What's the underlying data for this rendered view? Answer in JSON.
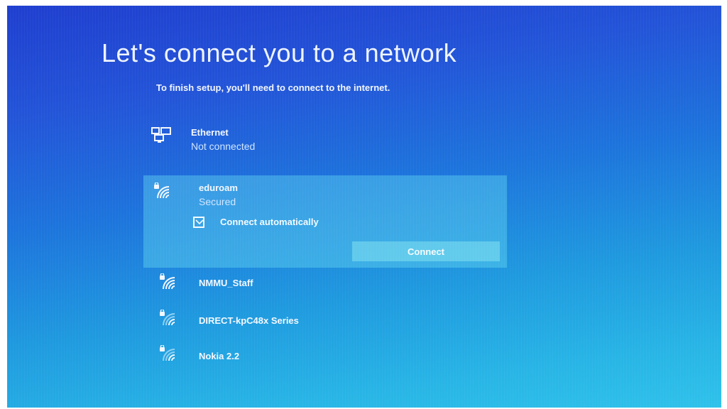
{
  "page": {
    "title": "Let's connect you to a network",
    "subtitle": "To finish setup, you'll need to connect to the internet."
  },
  "ethernet": {
    "icon": "ethernet-icon",
    "name": "Ethernet",
    "status": "Not connected"
  },
  "selected_network": {
    "icon": "wifi-secured-icon",
    "name": "eduroam",
    "status": "Secured",
    "connect_automatically": {
      "label": "Connect automatically",
      "checked": true
    },
    "connect_label": "Connect"
  },
  "networks": [
    {
      "icon": "wifi-secured-icon",
      "name": "NMMU_Staff",
      "signal": "strong"
    },
    {
      "icon": "wifi-secured-icon",
      "name": "DIRECT-kpC48x Series",
      "signal": "weak"
    },
    {
      "icon": "wifi-secured-icon",
      "name": "Nokia 2.2",
      "signal": "weak"
    }
  ],
  "colors": {
    "background_top": "#1f3fcf",
    "background_bottom": "#2fc2ea",
    "selected_panel": "#64dcf0",
    "text": "#ffffff",
    "status_text": "#cfe6ff"
  }
}
